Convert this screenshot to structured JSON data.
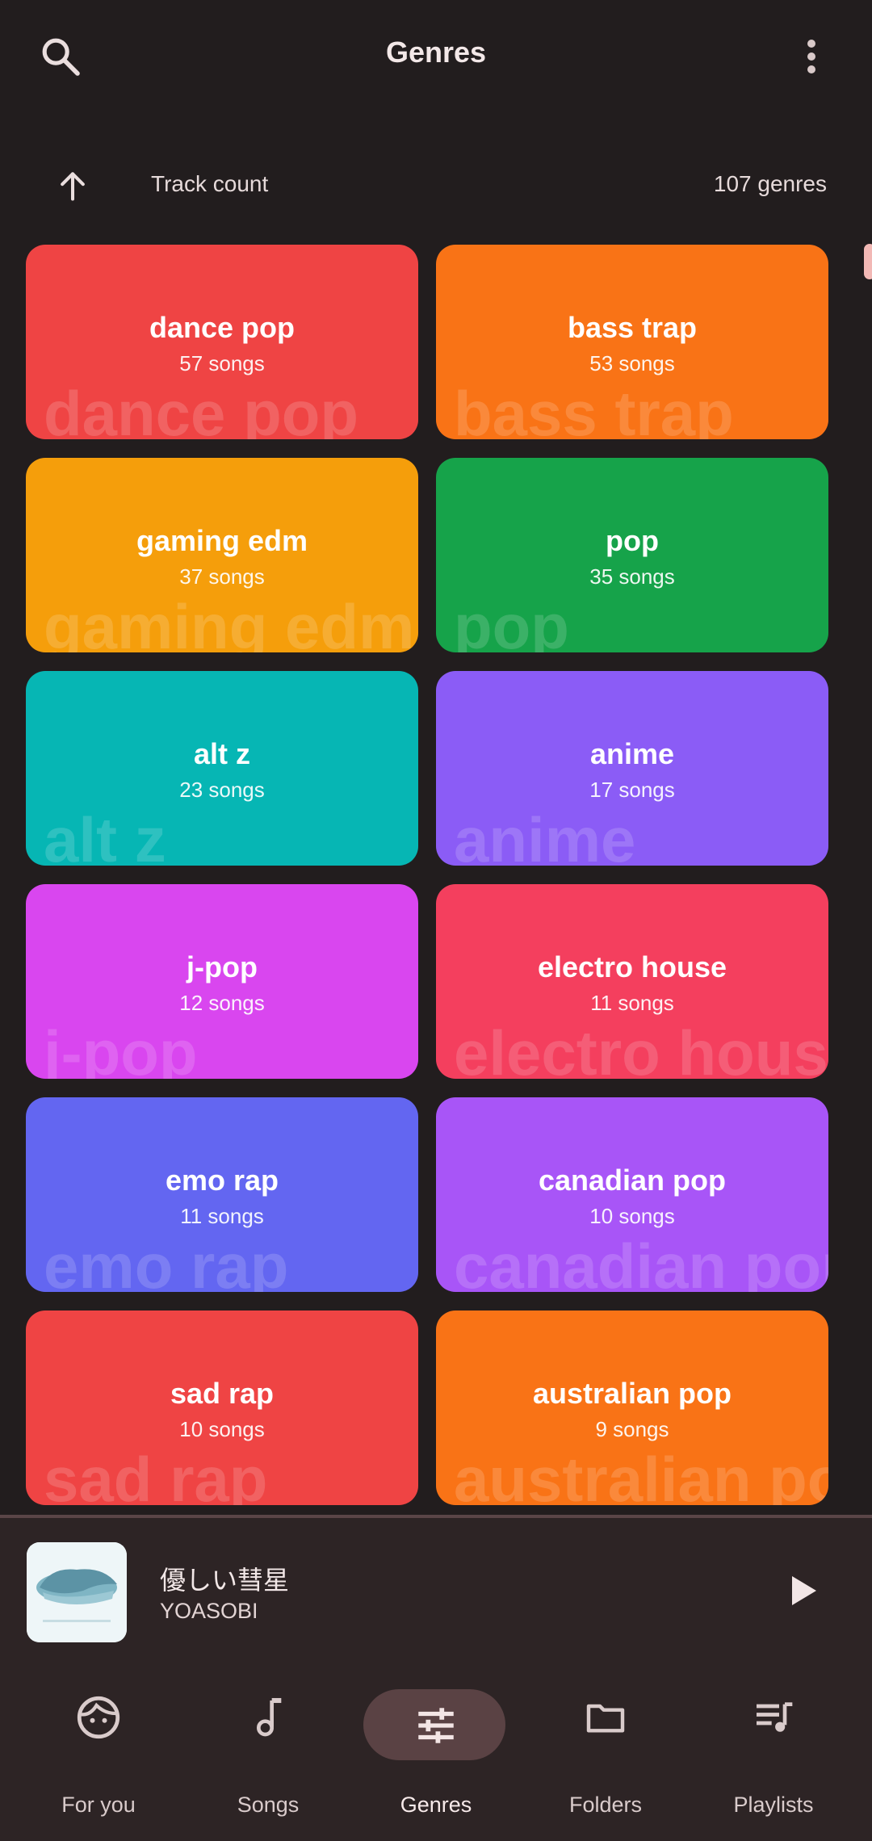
{
  "header": {
    "title": "Genres",
    "search_icon": "search-icon",
    "more_icon": "more-vert-icon"
  },
  "sort": {
    "direction_icon": "arrow-up-icon",
    "label": "Track count",
    "count": "107 genres"
  },
  "genres": [
    {
      "name": "dance pop",
      "songs": "57 songs",
      "bg": "dance pop",
      "color": "#ef4444"
    },
    {
      "name": "bass trap",
      "songs": "53 songs",
      "bg": "bass trap",
      "color": "#f97316"
    },
    {
      "name": "gaming edm",
      "songs": "37 songs",
      "bg": "gaming edm",
      "color": "#f59e0b"
    },
    {
      "name": "pop",
      "songs": "35 songs",
      "bg": "pop",
      "color": "#16a34a"
    },
    {
      "name": "alt z",
      "songs": "23 songs",
      "bg": "alt z",
      "color": "#06b6b4"
    },
    {
      "name": "anime",
      "songs": "17 songs",
      "bg": "anime",
      "color": "#8b5cf6"
    },
    {
      "name": "j-pop",
      "songs": "12 songs",
      "bg": "j-pop",
      "color": "#d946ef"
    },
    {
      "name": "electro house",
      "songs": "11 songs",
      "bg": "electro house",
      "color": "#f43f5e"
    },
    {
      "name": "emo rap",
      "songs": "11 songs",
      "bg": "emo rap",
      "color": "#6366f1"
    },
    {
      "name": "canadian pop",
      "songs": "10 songs",
      "bg": "canadian pop",
      "color": "#a855f7"
    },
    {
      "name": "sad rap",
      "songs": "10 songs",
      "bg": "sad rap",
      "color": "#ef4444"
    },
    {
      "name": "australian pop",
      "songs": "9 songs",
      "bg": "australian pop",
      "color": "#f97316"
    }
  ],
  "player": {
    "title": "優しい彗星",
    "artist": "YOASOBI",
    "play_icon": "play-icon"
  },
  "nav": [
    {
      "label": "For you",
      "icon": "face-icon"
    },
    {
      "label": "Songs",
      "icon": "music-note-icon"
    },
    {
      "label": "Genres",
      "icon": "tune-icon",
      "active": true
    },
    {
      "label": "Folders",
      "icon": "folder-icon"
    },
    {
      "label": "Playlists",
      "icon": "playlist-icon"
    }
  ],
  "colors": {
    "background": "#221d1e",
    "surface": "#2d2425",
    "nav_pill": "#5a4244",
    "scroll_thumb": "#f2b8b5"
  }
}
